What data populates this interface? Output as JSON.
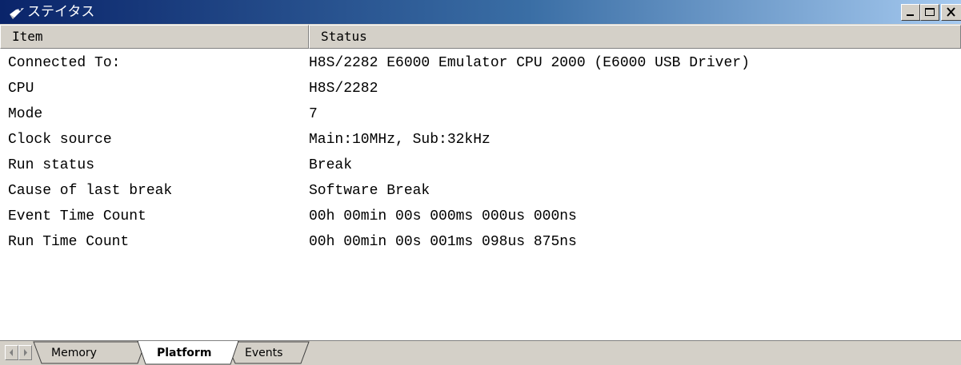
{
  "window": {
    "title": "ステイタス",
    "title_icon": "status-window-icon",
    "controls": {
      "minimize_icon": "minimize-icon",
      "maximize_icon": "maximize-icon",
      "close_icon": "close-icon"
    }
  },
  "table": {
    "columns": [
      "Item",
      "Status"
    ],
    "rows": [
      {
        "item": "Connected To:",
        "status": "H8S/2282 E6000 Emulator CPU 2000 (E6000 USB Driver)"
      },
      {
        "item": "CPU",
        "status": "H8S/2282"
      },
      {
        "item": "Mode",
        "status": "7"
      },
      {
        "item": "Clock source",
        "status": "Main:10MHz, Sub:32kHz"
      },
      {
        "item": "Run status",
        "status": "Break"
      },
      {
        "item": "Cause of last break",
        "status": "Software Break"
      },
      {
        "item": "Event Time Count",
        "status": "00h 00min 00s 000ms 000us 000ns"
      },
      {
        "item": "Run Time Count",
        "status": "00h 00min 00s 001ms 098us 875ns"
      }
    ]
  },
  "tabs": {
    "items": [
      "Memory",
      "Platform",
      "Events"
    ],
    "active": "Platform",
    "scroll_left_icon": "scroll-left-icon",
    "scroll_right_icon": "scroll-right-icon"
  },
  "colors": {
    "titlebar_start": "#0a246a",
    "titlebar_end": "#a6caf0",
    "face": "#d4d0c8"
  }
}
